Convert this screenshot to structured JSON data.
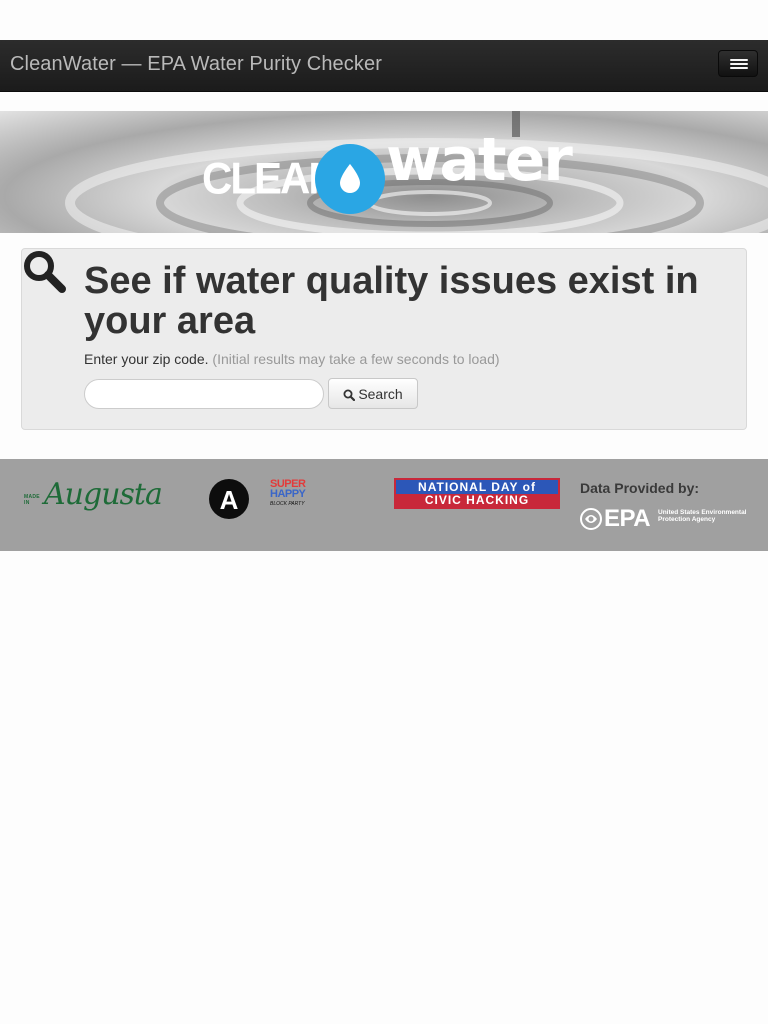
{
  "navbar": {
    "brand": "CleanWater — EPA Water Purity Checker",
    "menu_icon": "hamburger-menu-icon"
  },
  "hero": {
    "logo_clean": "CLEAN",
    "logo_water": "water",
    "drop_icon": "water-drop-icon",
    "drop_color": "#2aa6e4"
  },
  "search": {
    "icon": "search-icon",
    "headline": "See if water quality issues exist in your area",
    "prompt": "Enter your zip code.",
    "hint": "(Initial results may take a few seconds to load)",
    "zip_value": "",
    "zip_placeholder": "",
    "button_label": "Search"
  },
  "footer": {
    "made_in_prefix": "MADE IN",
    "made_in_name": "Augusta",
    "circle_letter": "A",
    "super_happy": [
      "SUPER",
      "HAPPY"
    ],
    "block_party": "BLOCK PARTY",
    "ndoch_row1": "NATIONAL DAY of",
    "ndoch_row2": "CIVIC HACKING",
    "data_provided_by": "Data Provided by:",
    "epa_name": "EPA",
    "epa_subtitle": "United States Environmental Protection Agency",
    "colors": {
      "augusta_green": "#1e6b38",
      "ndoch_red": "#c8283a",
      "ndoch_blue": "#2c57b8",
      "footer_bg": "#a0a0a0"
    }
  }
}
